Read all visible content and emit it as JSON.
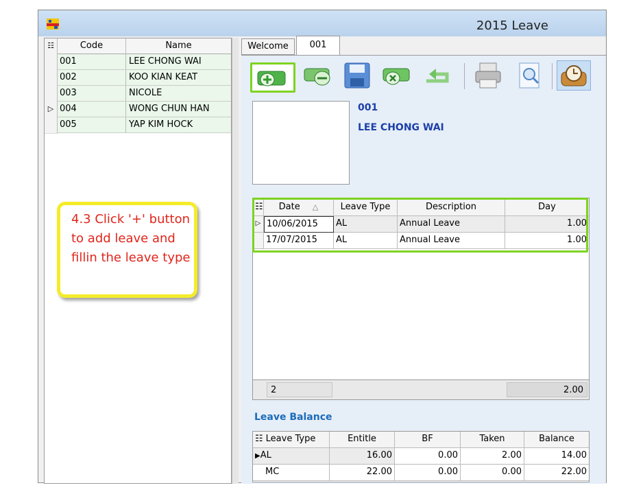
{
  "window": {
    "title": "2015 Leave"
  },
  "employee_list": {
    "columns": [
      "Code",
      "Name"
    ],
    "rows": [
      {
        "code": "001",
        "name": "LEE CHONG WAI"
      },
      {
        "code": "002",
        "name": "KOO KIAN KEAT"
      },
      {
        "code": "003",
        "name": "NICOLE"
      },
      {
        "code": "004",
        "name": "WONG CHUN HAN"
      },
      {
        "code": "005",
        "name": "YAP KIM HOCK"
      }
    ]
  },
  "tabs": [
    {
      "label": "Welcome"
    },
    {
      "label": "001"
    }
  ],
  "toolbar": {
    "icons": [
      "add-leave-icon",
      "remove-leave-icon",
      "save-icon",
      "cancel-icon",
      "undo-icon",
      "print-icon",
      "preview-icon",
      "timer-icon"
    ]
  },
  "employee": {
    "code": "001",
    "name": "LEE CHONG WAI"
  },
  "leave_grid": {
    "columns": [
      "Date",
      "Leave Type",
      "Description",
      "Day"
    ],
    "rows": [
      {
        "date": "10/06/2015",
        "type": "AL",
        "desc": "Annual Leave",
        "day": "1.00"
      },
      {
        "date": "17/07/2015",
        "type": "AL",
        "desc": "Annual Leave",
        "day": "1.00"
      }
    ],
    "footer_count": "2",
    "footer_total": "2.00"
  },
  "balance": {
    "title": "Leave Balance",
    "columns": [
      "Leave Type",
      "Entitle",
      "BF",
      "Taken",
      "Balance"
    ],
    "rows": [
      {
        "type": "AL",
        "entitle": "16.00",
        "bf": "0.00",
        "taken": "2.00",
        "balance": "14.00"
      },
      {
        "type": "MC",
        "entitle": "22.00",
        "bf": "0.00",
        "taken": "0.00",
        "balance": "22.00"
      }
    ]
  },
  "callout": {
    "text": "4.3 Click '+' button to add leave and fillin the leave type"
  },
  "colors": {
    "highlight": "#7dd321",
    "callout_border": "#f4ec2a",
    "callout_text": "#e0251b",
    "accent": "#1c3fa8"
  }
}
